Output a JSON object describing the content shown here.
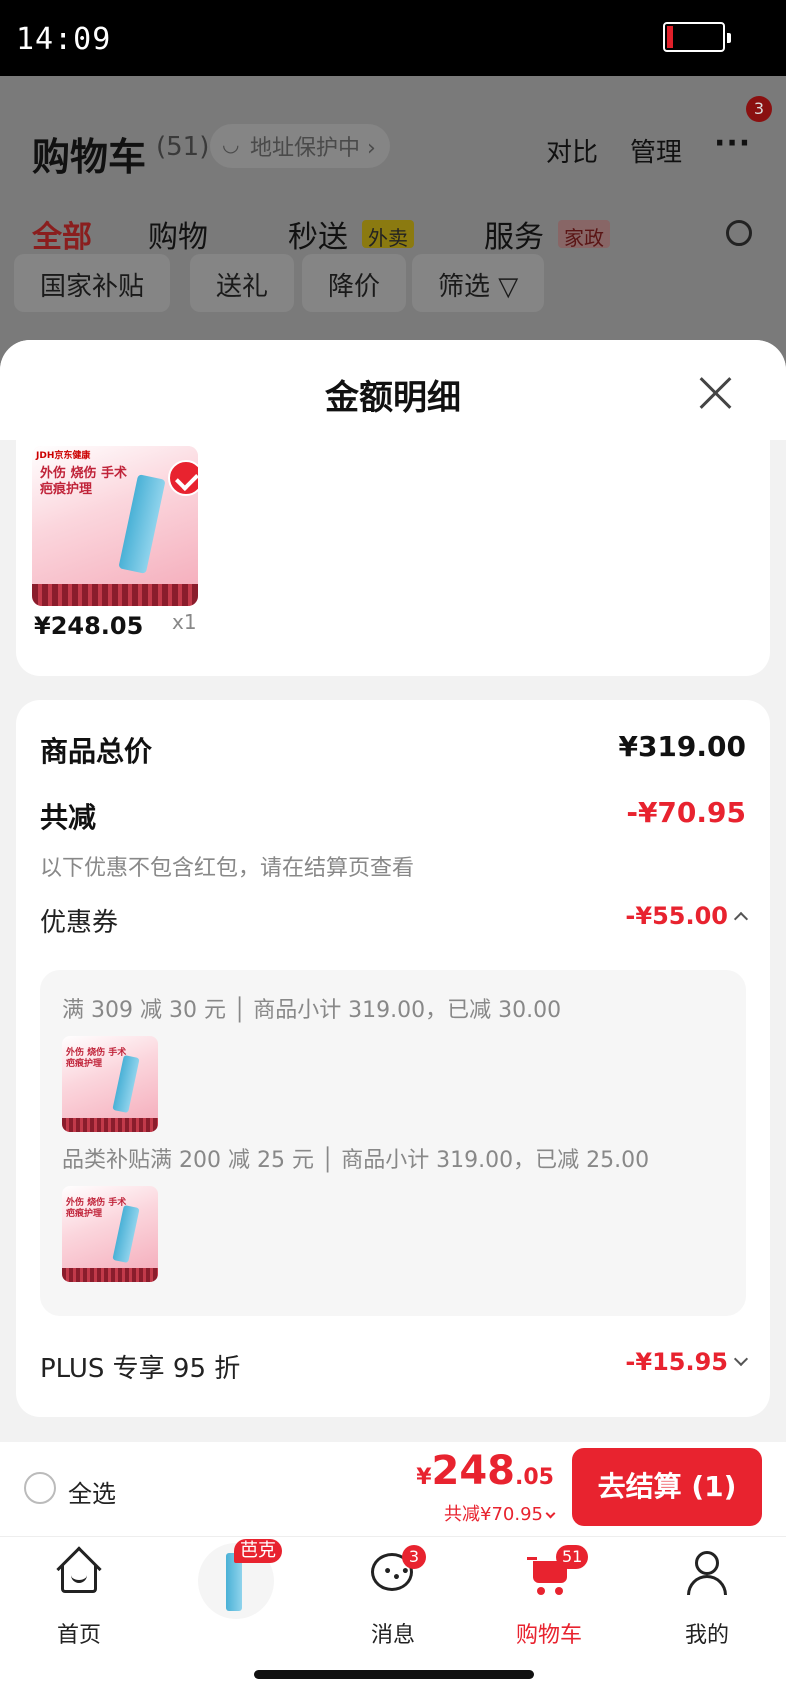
{
  "status": {
    "time": "14:09"
  },
  "background": {
    "title": "购物车",
    "count": "(51)",
    "address": "地址保护中 ›",
    "compare": "对比",
    "manage": "管理",
    "more": "···",
    "more_badge": "3",
    "tabs": [
      "全部",
      "购物",
      "秒送",
      "服务"
    ],
    "tab_tags": {
      "waimai": "外卖",
      "jiazheng": "家政"
    },
    "filters": [
      "国家补贴",
      "送礼",
      "降价",
      "筛选 ▽"
    ]
  },
  "sheet": {
    "title": "金额明细",
    "product": {
      "brand": "JDH京东健康",
      "image_text": "外伤 烧伤 手术\n疤痕护理",
      "price": "¥248.05",
      "qty": "x1"
    },
    "summary": {
      "total_label": "商品总价",
      "total_value": "¥319.00",
      "reduce_label": "共减",
      "reduce_value": "-¥70.95",
      "note": "以下优惠不包含红包，请在结算页查看",
      "coupon_label": "优惠券",
      "coupon_value": "-¥55.00",
      "coupons": [
        {
          "text": "满 309 减 30 元 │ 商品小计 319.00，已减 30.00",
          "thumb_text": "外伤 烧伤 手术\n疤痕护理"
        },
        {
          "text": "品类补贴满 200 减 25 元 │ 商品小计 319.00，已减 25.00",
          "thumb_text": "外伤 烧伤 手术\n疤痕护理"
        }
      ],
      "plus_label": "PLUS 专享 95 折",
      "plus_value": "-¥15.95"
    }
  },
  "checkout": {
    "select_all": "全选",
    "currency": "¥",
    "price_int": "248",
    "price_dec": ".05",
    "discount": "共减¥70.95",
    "button": "去结算 (1)"
  },
  "tabbar": {
    "home": "首页",
    "promo_tag": "芭克",
    "messages": "消息",
    "messages_badge": "3",
    "cart": "购物车",
    "cart_badge": "51",
    "me": "我的"
  },
  "colors": {
    "accent": "#e8232f",
    "overlay": "#7a7a7a"
  }
}
